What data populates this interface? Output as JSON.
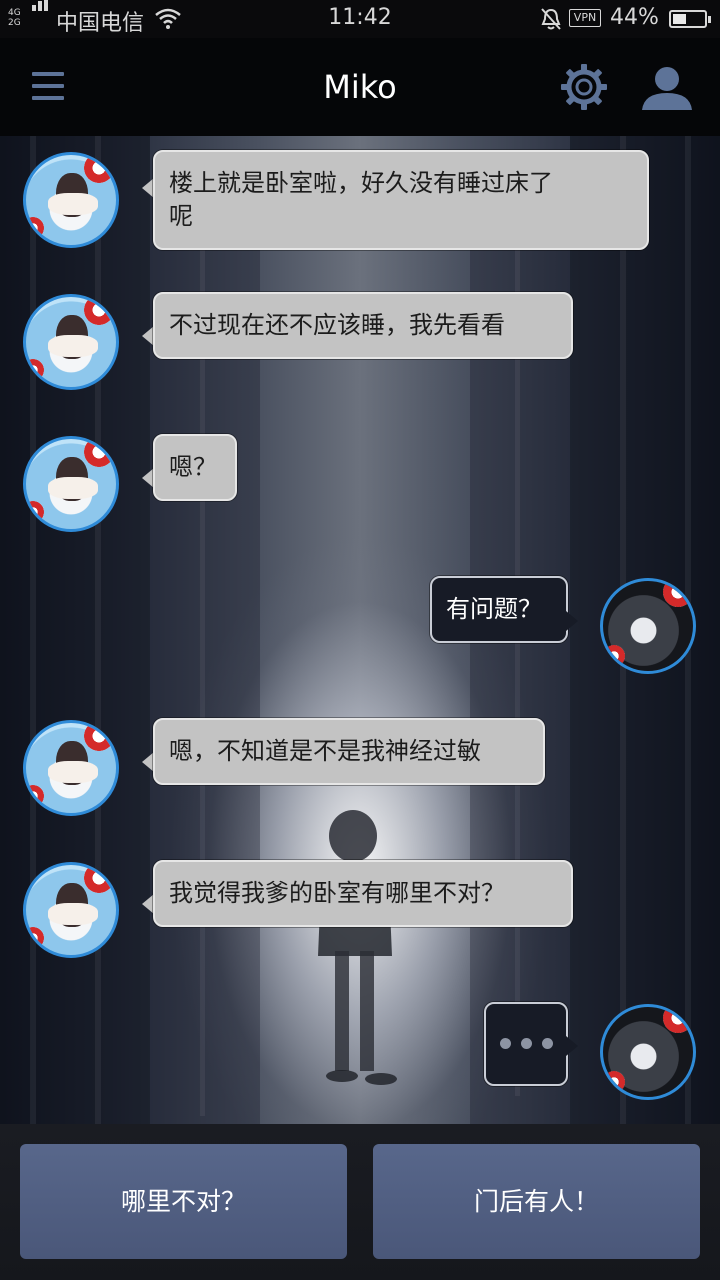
{
  "status_bar": {
    "network": "4G\n2G",
    "carrier": "中国电信",
    "time": "11:42",
    "vpn": "VPN",
    "battery": "44%",
    "battery_level": 0.44,
    "icons": [
      "signal-icon",
      "wifi-icon",
      "mute-bell-icon",
      "battery-icon"
    ]
  },
  "header": {
    "title": "Miko",
    "accent_color": "#5d7398",
    "icons": [
      "menu-icon",
      "gear-icon",
      "user-icon"
    ]
  },
  "messages": [
    {
      "side": "left",
      "speaker": "Miko",
      "text": "楼上就是卧室啦，好久没有睡过床了\n呢"
    },
    {
      "side": "left",
      "speaker": "Miko",
      "text": "不过现在还不应该睡，我先看看"
    },
    {
      "side": "left",
      "speaker": "Miko",
      "text": "嗯？"
    },
    {
      "side": "right",
      "speaker": "me",
      "text": "有问题？"
    },
    {
      "side": "left",
      "speaker": "Miko",
      "text": "嗯，不知道是不是我神经过敏"
    },
    {
      "side": "left",
      "speaker": "Miko",
      "text": "我觉得我爹的卧室有哪里不对？"
    },
    {
      "side": "right",
      "speaker": "me",
      "text": ""
    }
  ],
  "choices": [
    {
      "label": "哪里不对？"
    },
    {
      "label": "门后有人！"
    }
  ],
  "colors": {
    "left_bubble": "#c3c3c3",
    "right_bubble": "#171b26",
    "choice_button": "#55648a",
    "avatar_ring": "#2f8bd8"
  }
}
